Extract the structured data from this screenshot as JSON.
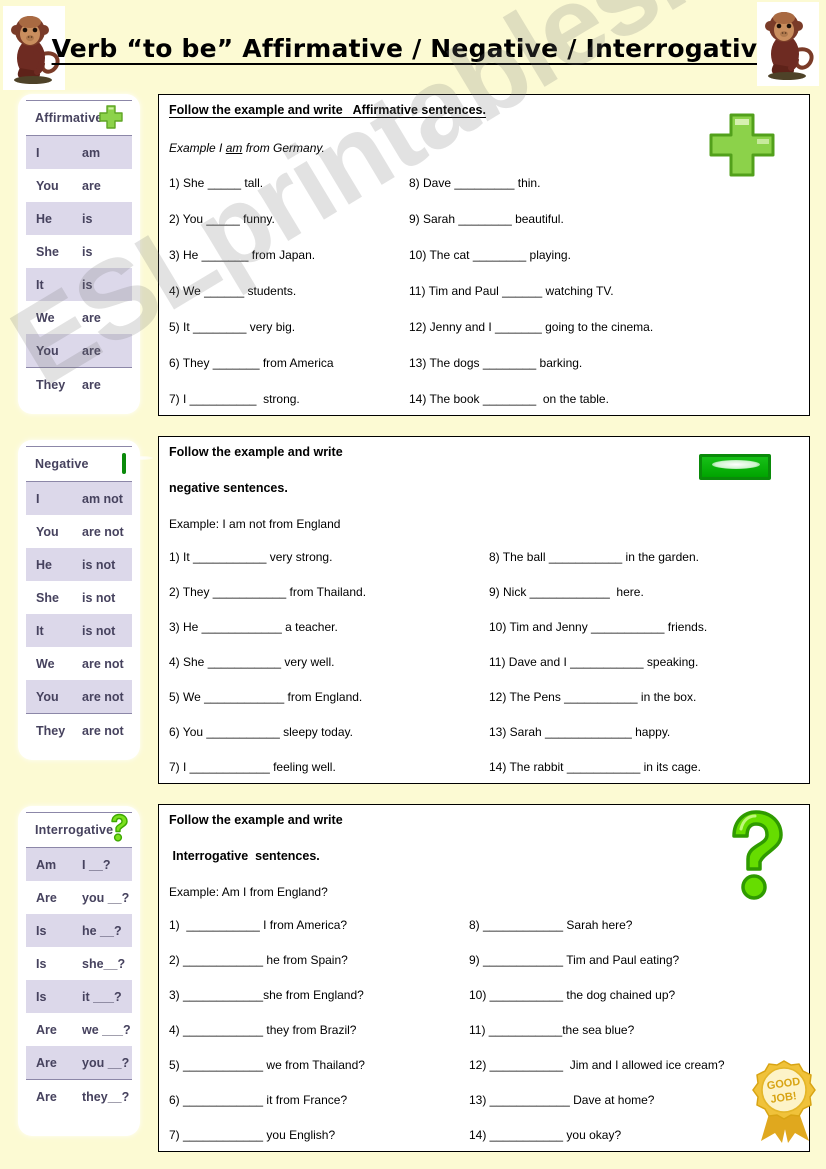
{
  "header": {
    "title": "Verb “to be” Affirmative / Negative / Interrogative",
    "monkey_left": "monkey-image",
    "monkey_right": "monkey-image"
  },
  "colors": {
    "page_background": "#FCFAD3",
    "card_background": "#FFFFFF",
    "table_alt_row": "#DCD8EA",
    "table_text": "#46425E",
    "green_icon": "#4FC63B",
    "badge_gold": "#E0A81E"
  },
  "tables": [
    {
      "title": "Affirmative",
      "icon": "green-plus-icon",
      "rows": [
        {
          "subject": "I",
          "verb": "am"
        },
        {
          "subject": "You",
          "verb": "are"
        },
        {
          "subject": "He",
          "verb": "is"
        },
        {
          "subject": "She",
          "verb": "is"
        },
        {
          "subject": "It",
          "verb": "is"
        },
        {
          "subject": "We",
          "verb": "are"
        },
        {
          "subject": "You",
          "verb": "are"
        },
        {
          "subject": "They",
          "verb": "are"
        }
      ]
    },
    {
      "title": "Negative",
      "icon": "green-minus-icon",
      "rows": [
        {
          "subject": "I",
          "verb": "am not"
        },
        {
          "subject": "You",
          "verb": "are not"
        },
        {
          "subject": "He",
          "verb": "is not"
        },
        {
          "subject": "She",
          "verb": "is not"
        },
        {
          "subject": "It",
          "verb": "is not"
        },
        {
          "subject": "We",
          "verb": "are not"
        },
        {
          "subject": "You",
          "verb": "are not"
        },
        {
          "subject": "They",
          "verb": "are not"
        }
      ]
    },
    {
      "title": "Interrogative",
      "icon": "green-question-icon",
      "rows": [
        {
          "subject": "Am",
          "verb": "I __?"
        },
        {
          "subject": "Are",
          "verb": "you __?"
        },
        {
          "subject": "Is",
          "verb": "he __?"
        },
        {
          "subject": "Is",
          "verb": "she__?"
        },
        {
          "subject": "Is",
          "verb": "it ___?"
        },
        {
          "subject": "Are",
          "verb": "we ___?"
        },
        {
          "subject": "Are",
          "verb": "you __?"
        },
        {
          "subject": "Are",
          "verb": "they__?"
        }
      ]
    }
  ],
  "exercises": [
    {
      "heading": "Follow the example and write   Affirmative sentences.",
      "heading_line2": "",
      "example_prefix": "Example   I ",
      "example_underlined": "am",
      "example_suffix": " from Germany.",
      "icon": "green-plus-icon",
      "left_items": [
        "1) She _____ tall.",
        "2) You _____ funny.",
        "3) He _______ from Japan.",
        "4) We ______ students.",
        "5) It ________ very big.",
        "6) They _______ from America",
        "7) I __________  strong."
      ],
      "right_items": [
        "8) Dave _________ thin.",
        "9) Sarah ________ beautiful.",
        "10) The cat ________ playing.",
        "11) Tim and Paul ______ watching TV.",
        "12) Jenny and I _______ going to the cinema.",
        "13) The dogs ________ barking.",
        "14) The book ________  on the table."
      ]
    },
    {
      "heading": "Follow the example and write",
      "heading_line2": "negative sentences.",
      "example_prefix": "Example: I am not from England",
      "example_underlined": "",
      "example_suffix": "",
      "icon": "green-minus-icon",
      "left_items": [
        "1) It ___________ very strong.",
        "2) They ___________ from Thailand.",
        "3) He ____________ a teacher.",
        "4) She ___________ very well.",
        "5) We ____________ from England.",
        "6) You ___________ sleepy today.",
        "7) I ____________ feeling well."
      ],
      "right_items": [
        "8) The ball ___________ in the garden.",
        "9) Nick ____________  here.",
        "10) Tim and Jenny ___________ friends.",
        "11) Dave and I ___________ speaking.",
        "12) The Pens ___________ in the box.",
        "13) Sarah _____________ happy.",
        "14) The rabbit ___________ in its cage."
      ]
    },
    {
      "heading": "Follow the example and write",
      "heading_line2": " Interrogative  sentences.",
      "example_prefix": "Example: Am I from England?",
      "example_underlined": "",
      "example_suffix": "",
      "icon": "green-question-icon",
      "left_items": [
        "1)  ___________ I from America?",
        "2) ____________ he from Spain?",
        "3) ____________she from England?",
        "4) ____________ they from Brazil?",
        "5) ____________ we from Thailand?",
        "6) ____________ it from France?",
        "7) ____________ you English?"
      ],
      "right_items": [
        "8) ____________ Sarah here?",
        "9) ____________ Tim and Paul eating?",
        "10) ___________ the dog chained up?",
        "11) ___________the sea blue?",
        "12) ___________  Jim and I allowed ice cream?",
        "13) ____________ Dave at home?",
        "14) ___________ you okay?"
      ]
    }
  ],
  "badge": {
    "line1": "GOOD",
    "line2": "JOB!"
  },
  "watermark": {
    "text": "ESLprintables.com"
  }
}
